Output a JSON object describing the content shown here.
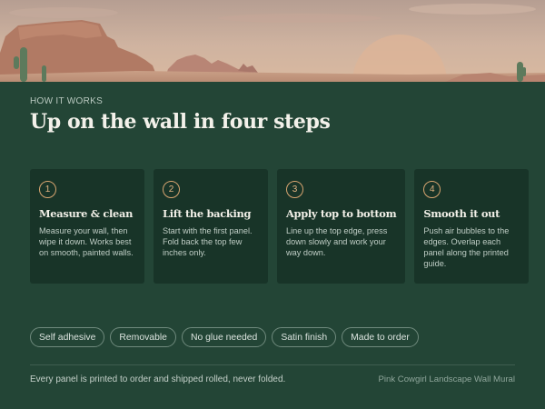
{
  "section": {
    "eyebrow": "HOW IT WORKS",
    "title": "Up on the wall in four steps"
  },
  "steps": [
    {
      "number": "1",
      "title": "Measure & clean",
      "description": "Measure your wall, then wipe it down. Works best on smooth, painted walls."
    },
    {
      "number": "2",
      "title": "Lift the backing",
      "description": "Start with the first panel. Fold back the top few inches only."
    },
    {
      "number": "3",
      "title": "Apply top to bottom",
      "description": "Line up the top edge, press down slowly and work your way down."
    },
    {
      "number": "4",
      "title": "Smooth it out",
      "description": "Push air bubbles to the edges. Overlap each panel along the printed guide."
    }
  ],
  "tags": [
    "Self adhesive",
    "Removable",
    "No glue needed",
    "Satin finish",
    "Made to order"
  ],
  "footer": {
    "note": "Every panel is printed to order and shipped rolled, never folded.",
    "product": "Pink Cowgirl Landscape Wall Mural"
  },
  "colors": {
    "background": "#234536",
    "card": "#183428",
    "accent": "#d7a470"
  }
}
